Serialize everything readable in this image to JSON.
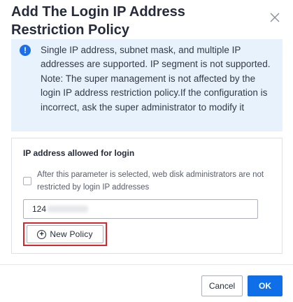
{
  "dialog": {
    "title": "Add The Login IP Address Restriction Policy",
    "close_icon": "close-icon"
  },
  "notice": {
    "icon": "info-icon",
    "icon_glyph": "!",
    "text": "Single IP address, subnet mask, and multiple IP addresses are supported. IP segment is not supported. Note: The super management is not affected by the login IP address restriction policy.If the configuration is incorrect, ask the super administrator to modify it"
  },
  "panel": {
    "title": "IP address allowed for login",
    "checkbox": {
      "checked": false,
      "label": "After this parameter is selected, web disk administrators are not restricted by login IP addresses"
    },
    "ip_input": {
      "value": "124"
    },
    "new_policy": {
      "label": "New Policy",
      "icon": "plus-circle-icon",
      "icon_glyph": "+"
    }
  },
  "footer": {
    "cancel_label": "Cancel",
    "ok_label": "OK"
  },
  "colors": {
    "primary": "#0e6fe8",
    "notice_bg": "#e8f2fd",
    "highlight": "#d9262e"
  }
}
